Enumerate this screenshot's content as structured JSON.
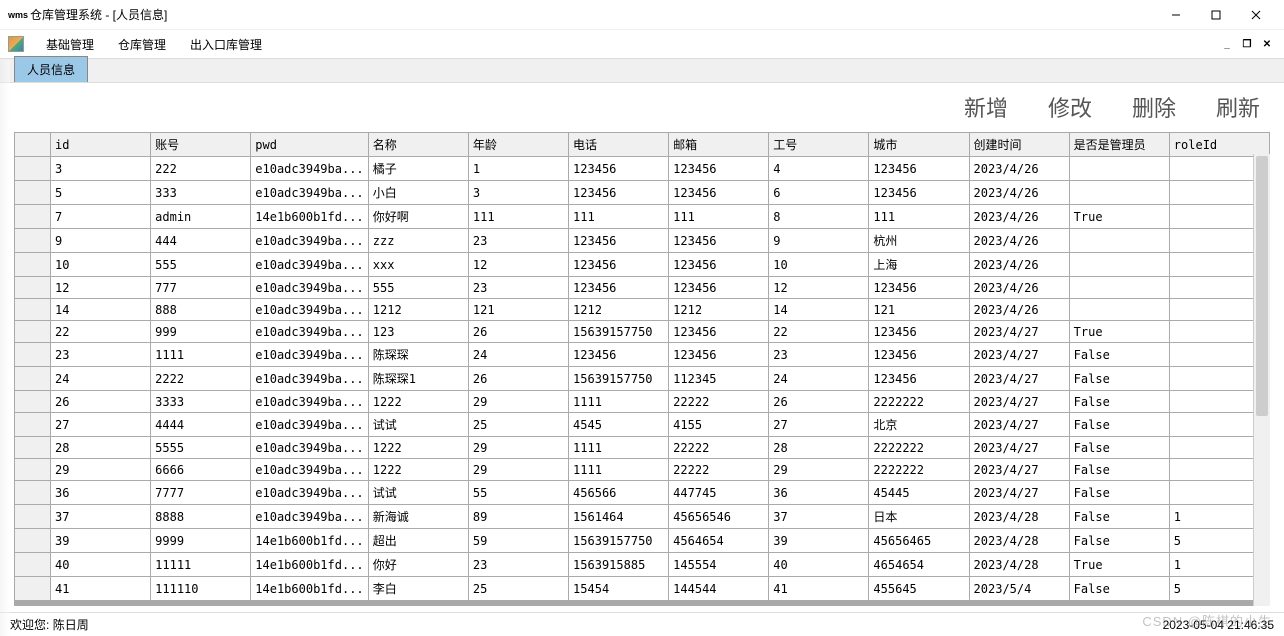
{
  "window": {
    "icon_text": "wms",
    "title": "仓库管理系统 - [人员信息]"
  },
  "menubar": {
    "items": [
      "基础管理",
      "仓库管理",
      "出入口库管理"
    ]
  },
  "tabs": {
    "active": "人员信息"
  },
  "toolbar": {
    "add": "新增",
    "edit": "修改",
    "delete": "删除",
    "refresh": "刷新"
  },
  "grid": {
    "columns": [
      "id",
      "账号",
      "pwd",
      "名称",
      "年龄",
      "电话",
      "邮箱",
      "工号",
      "城市",
      "创建时间",
      "是否是管理员",
      "roleId"
    ],
    "rows": [
      {
        "id": "3",
        "acc": "222",
        "pwd": "e10adc3949ba...",
        "name": "橘子",
        "age": "1",
        "tel": "123456",
        "mail": "123456",
        "emp": "4",
        "city": "123456",
        "ct": "2023/4/26",
        "admin": "",
        "role": ""
      },
      {
        "id": "5",
        "acc": "333",
        "pwd": "e10adc3949ba...",
        "name": "小白",
        "age": "3",
        "tel": "123456",
        "mail": "123456",
        "emp": "6",
        "city": "123456",
        "ct": "2023/4/26",
        "admin": "",
        "role": ""
      },
      {
        "id": "7",
        "acc": "admin",
        "pwd": "14e1b600b1fd...",
        "name": "你好啊",
        "age": "111",
        "tel": "111",
        "mail": "111",
        "emp": "8",
        "city": "111",
        "ct": "2023/4/26",
        "admin": "True",
        "role": ""
      },
      {
        "id": "9",
        "acc": "444",
        "pwd": "e10adc3949ba...",
        "name": "zzz",
        "age": "23",
        "tel": "123456",
        "mail": "123456",
        "emp": "9",
        "city": "杭州",
        "ct": "2023/4/26",
        "admin": "",
        "role": ""
      },
      {
        "id": "10",
        "acc": "555",
        "pwd": "e10adc3949ba...",
        "name": "xxx",
        "age": "12",
        "tel": "123456",
        "mail": "123456",
        "emp": "10",
        "city": "上海",
        "ct": "2023/4/26",
        "admin": "",
        "role": ""
      },
      {
        "id": "12",
        "acc": "777",
        "pwd": "e10adc3949ba...",
        "name": "555",
        "age": "23",
        "tel": "123456",
        "mail": "123456",
        "emp": "12",
        "city": "123456",
        "ct": "2023/4/26",
        "admin": "",
        "role": ""
      },
      {
        "id": "14",
        "acc": "888",
        "pwd": "e10adc3949ba...",
        "name": "1212",
        "age": "121",
        "tel": "1212",
        "mail": "1212",
        "emp": "14",
        "city": "121",
        "ct": "2023/4/26",
        "admin": "",
        "role": ""
      },
      {
        "id": "22",
        "acc": "999",
        "pwd": "e10adc3949ba...",
        "name": "123",
        "age": "26",
        "tel": "15639157750",
        "mail": "123456",
        "emp": "22",
        "city": "123456",
        "ct": "2023/4/27",
        "admin": "True",
        "role": ""
      },
      {
        "id": "23",
        "acc": "1111",
        "pwd": "e10adc3949ba...",
        "name": "陈琛琛",
        "age": "24",
        "tel": "123456",
        "mail": "123456",
        "emp": "23",
        "city": "123456",
        "ct": "2023/4/27",
        "admin": "False",
        "role": ""
      },
      {
        "id": "24",
        "acc": "2222",
        "pwd": "e10adc3949ba...",
        "name": "陈琛琛1",
        "age": "26",
        "tel": "15639157750",
        "mail": "112345",
        "emp": "24",
        "city": "123456",
        "ct": "2023/4/27",
        "admin": "False",
        "role": ""
      },
      {
        "id": "26",
        "acc": "3333",
        "pwd": "e10adc3949ba...",
        "name": "1222",
        "age": "29",
        "tel": "1111",
        "mail": "22222",
        "emp": "26",
        "city": "2222222",
        "ct": "2023/4/27",
        "admin": "False",
        "role": ""
      },
      {
        "id": "27",
        "acc": "4444",
        "pwd": "e10adc3949ba...",
        "name": "试试",
        "age": "25",
        "tel": "4545",
        "mail": "4155",
        "emp": "27",
        "city": "北京",
        "ct": "2023/4/27",
        "admin": "False",
        "role": ""
      },
      {
        "id": "28",
        "acc": "5555",
        "pwd": "e10adc3949ba...",
        "name": "1222",
        "age": "29",
        "tel": "1111",
        "mail": "22222",
        "emp": "28",
        "city": "2222222",
        "ct": "2023/4/27",
        "admin": "False",
        "role": ""
      },
      {
        "id": "29",
        "acc": "6666",
        "pwd": "e10adc3949ba...",
        "name": "1222",
        "age": "29",
        "tel": "1111",
        "mail": "22222",
        "emp": "29",
        "city": "2222222",
        "ct": "2023/4/27",
        "admin": "False",
        "role": ""
      },
      {
        "id": "36",
        "acc": "7777",
        "pwd": "e10adc3949ba...",
        "name": "试试",
        "age": "55",
        "tel": "456566",
        "mail": "447745",
        "emp": "36",
        "city": "45445",
        "ct": "2023/4/27",
        "admin": "False",
        "role": ""
      },
      {
        "id": "37",
        "acc": "8888",
        "pwd": "e10adc3949ba...",
        "name": "新海诚",
        "age": "89",
        "tel": "1561464",
        "mail": "45656546",
        "emp": "37",
        "city": "日本",
        "ct": "2023/4/28",
        "admin": "False",
        "role": "1"
      },
      {
        "id": "39",
        "acc": "9999",
        "pwd": "14e1b600b1fd...",
        "name": "超出",
        "age": "59",
        "tel": "15639157750",
        "mail": "4564654",
        "emp": "39",
        "city": "45656465",
        "ct": "2023/4/28",
        "admin": "False",
        "role": "5"
      },
      {
        "id": "40",
        "acc": "11111",
        "pwd": "14e1b600b1fd...",
        "name": "你好",
        "age": "23",
        "tel": "1563915885",
        "mail": "145554",
        "emp": "40",
        "city": "4654654",
        "ct": "2023/4/28",
        "admin": "True",
        "role": "1"
      },
      {
        "id": "41",
        "acc": "111110",
        "pwd": "14e1b600b1fd...",
        "name": "李白",
        "age": "25",
        "tel": "15454",
        "mail": "144544",
        "emp": "41",
        "city": "455645",
        "ct": "2023/5/4",
        "admin": "False",
        "role": "5"
      }
    ]
  },
  "statusbar": {
    "welcome_label": "欢迎您:",
    "username": "陈日周",
    "timestamp": "2023-05-04 21:46:35"
  },
  "watermark": "CSDN @陈棋的小生"
}
